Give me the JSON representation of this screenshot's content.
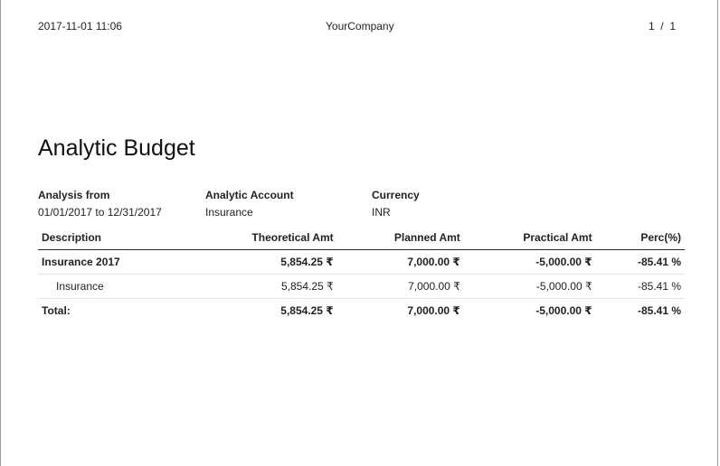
{
  "header": {
    "datetime": "2017-11-01 11:06",
    "company": "YourCompany",
    "pager": "1  /  1"
  },
  "title": "Analytic Budget",
  "info": {
    "analysis_from_label": "Analysis from",
    "analysis_from_value": "01/01/2017 to 12/31/2017",
    "account_label": "Analytic Account",
    "account_value": "Insurance",
    "currency_label": "Currency",
    "currency_value": "INR"
  },
  "table": {
    "columns": [
      "Description",
      "Theoretical Amt",
      "Planned Amt",
      "Practical Amt",
      "Perc(%)"
    ],
    "rows": [
      {
        "description": "Insurance 2017",
        "theoretical": "5,854.25 ₹",
        "planned": "7,000.00 ₹",
        "practical": "-5,000.00 ₹",
        "perc": "-85.41 %"
      },
      {
        "description": "Insurance",
        "theoretical": "5,854.25 ₹",
        "planned": "7,000.00 ₹",
        "practical": "-5,000.00 ₹",
        "perc": "-85.41 %"
      },
      {
        "description": "Total:",
        "theoretical": "5,854.25 ₹",
        "planned": "7,000.00 ₹",
        "practical": "-5,000.00 ₹",
        "perc": "-85.41 %"
      }
    ]
  }
}
